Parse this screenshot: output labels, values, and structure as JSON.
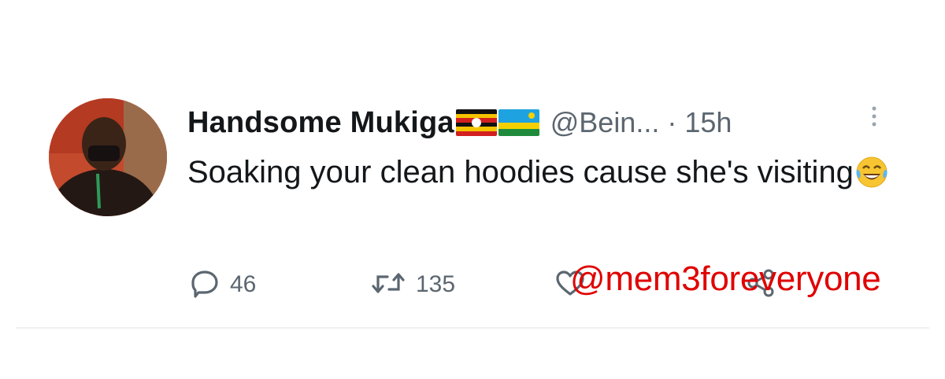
{
  "tweet": {
    "display_name": "Handsome Mukiga",
    "handle": "@Bein...",
    "separator": "·",
    "timestamp": "15h",
    "text": "Soaking your clean hoodies cause she's visiting",
    "emoji": "face-with-tears-of-joy",
    "flags": [
      "uganda-flag",
      "rwanda-flag"
    ],
    "replies": "46",
    "retweets": "135"
  },
  "watermark": "@mem3foreveryone",
  "icons": {
    "reply": "reply-icon",
    "retweet": "retweet-icon",
    "like": "like-icon",
    "share": "share-icon",
    "more": "more-icon"
  },
  "colors": {
    "text": "#14171a",
    "muted": "#5b6670",
    "watermark": "#e00000"
  }
}
